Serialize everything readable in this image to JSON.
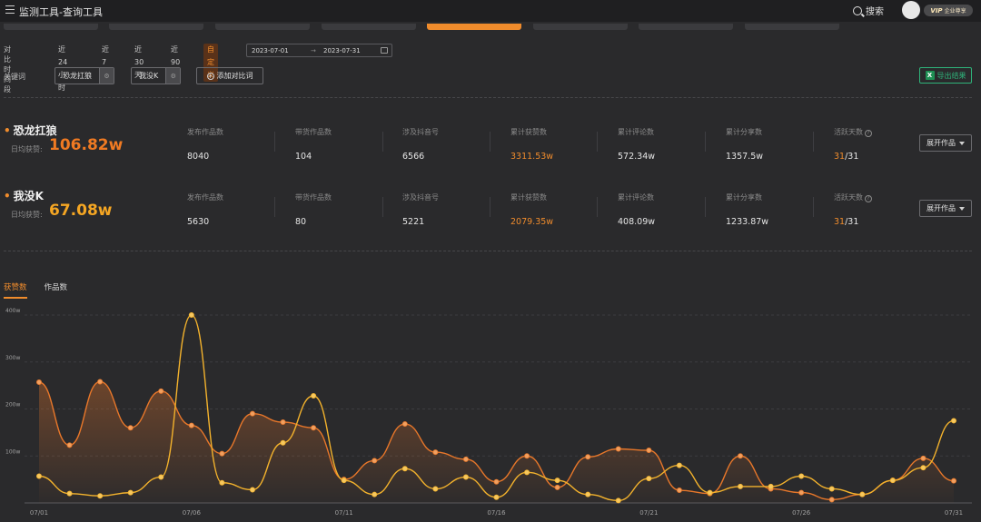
{
  "app": {
    "title": "监测工具-查询工具",
    "search_label": "搜索",
    "vip_text": "VIP",
    "vip_sub": "企业尊享"
  },
  "filters": {
    "compare_label": "对比时间段",
    "ranges": [
      "近24小时",
      "近7天",
      "近30天",
      "近90天",
      "自定义"
    ],
    "active_range": "自定义",
    "date_start": "2023-07-01",
    "date_sep": "→",
    "date_end": "2023-07-31"
  },
  "keywords": {
    "label": "关键词",
    "tags": [
      "恐龙扛狼",
      "我没K"
    ],
    "add_label": "添加对比词",
    "export_label": "导出结果"
  },
  "stats": {
    "avg_label": "日均获赞:",
    "expand_label": "展开作品",
    "columns": [
      "发布作品数",
      "带货作品数",
      "涉及抖音号",
      "累计获赞数",
      "累计评论数",
      "累计分享数",
      "活跃天数"
    ],
    "rows": [
      {
        "name": "恐龙扛狼",
        "avg": "106.82w",
        "avg_color": "#f07a22",
        "values": [
          "8040",
          "104",
          "6566",
          "3311.53w",
          "572.34w",
          "1357.5w"
        ],
        "active_days": "31",
        "total_days": "/31"
      },
      {
        "name": "我没K",
        "avg": "67.08w",
        "avg_color": "#f5a623",
        "values": [
          "5630",
          "80",
          "5221",
          "2079.35w",
          "408.09w",
          "1233.87w"
        ],
        "active_days": "31",
        "total_days": "/31"
      }
    ]
  },
  "chart_tabs": [
    "获赞数",
    "作品数"
  ],
  "colors": {
    "accent": "#f08c2c",
    "series1": "#e8772a",
    "series2": "#f3b22c",
    "excel": "#2fb37a"
  },
  "chart_data": {
    "type": "line",
    "title": "",
    "xlabel": "",
    "ylabel": "",
    "x": [
      "07/01",
      "07/02",
      "07/03",
      "07/04",
      "07/05",
      "07/06",
      "07/07",
      "07/08",
      "07/09",
      "07/10",
      "07/11",
      "07/12",
      "07/13",
      "07/14",
      "07/15",
      "07/16",
      "07/17",
      "07/18",
      "07/19",
      "07/20",
      "07/21",
      "07/22",
      "07/23",
      "07/24",
      "07/25",
      "07/26",
      "07/27",
      "07/28",
      "07/29",
      "07/30",
      "07/31"
    ],
    "x_tick_labels": [
      "07/01",
      "07/06",
      "07/11",
      "07/16",
      "07/21",
      "07/26",
      "07/31"
    ],
    "y_tick_labels": [
      "100w",
      "200w",
      "300w",
      "400w"
    ],
    "y_ticks": [
      100,
      200,
      300,
      400
    ],
    "ylim": [
      0,
      400
    ],
    "grid": true,
    "series": [
      {
        "name": "恐龙扛狼",
        "values": [
          257,
          123,
          258,
          160,
          238,
          165,
          105,
          190,
          172,
          160,
          50,
          90,
          168,
          108,
          93,
          45,
          100,
          33,
          98,
          115,
          112,
          27,
          20,
          100,
          30,
          22,
          7,
          18,
          48,
          95,
          47
        ]
      },
      {
        "name": "我没K",
        "values": [
          57,
          20,
          15,
          22,
          55,
          400,
          43,
          28,
          128,
          228,
          48,
          18,
          73,
          30,
          55,
          12,
          65,
          48,
          18,
          5,
          52,
          80,
          22,
          35,
          35,
          57,
          30,
          18,
          48,
          75,
          175
        ]
      }
    ]
  }
}
